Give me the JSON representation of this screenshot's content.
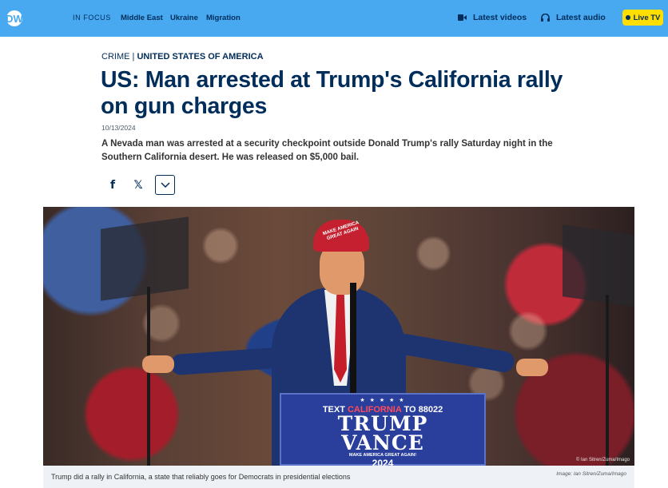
{
  "header": {
    "logo_text": "DW",
    "in_focus_label": "IN FOCUS",
    "topics": [
      "Middle East",
      "Ukraine",
      "Migration"
    ],
    "latest_videos_label": "Latest videos",
    "latest_audio_label": "Latest audio",
    "live_tv_label": "Live TV",
    "colors": {
      "bar": "#48a8f0",
      "text": "#002d5a",
      "live_tv_bg": "#ffde00"
    },
    "icons": {
      "videos": "video-camera-icon",
      "audio": "headphones-icon",
      "live": "live-dot-icon"
    }
  },
  "article": {
    "category": "CRIME",
    "separator": "|",
    "country": "UNITED STATES OF AMERICA",
    "headline": "US: Man arrested at Trump's California rally on gun charges",
    "date": "10/13/2024",
    "teaser": "A Nevada man was arrested at a security checkpoint outside Donald Trump's rally Saturday night in the Southern California desert. He was released on $5,000 bail.",
    "share": {
      "facebook_glyph": "f",
      "x_glyph": "𝕏",
      "icons": [
        "facebook-icon",
        "x-icon",
        "chevron-down-icon"
      ]
    }
  },
  "photo": {
    "cap_text": "MAKE AMERICA GREAT AGAIN",
    "podium_stars": "★ ★ ★ ★ ★",
    "podium_line_prefix": "TEXT ",
    "podium_line_highlight": "CALIFORNIA",
    "podium_line_suffix": " TO 88022",
    "podium_name_1": "TRUMP",
    "podium_name_2": "VANCE",
    "podium_slogan": "MAKE AMERICA GREAT AGAIN!",
    "podium_year": "2024",
    "overlay_credit": "© Ian Sitren/Zuma/Imago",
    "caption": "Trump did a rally in California, a state that reliably goes for Democrats in presidential elections",
    "credit": "Image: Ian Sitren/Zuma/Imago"
  }
}
